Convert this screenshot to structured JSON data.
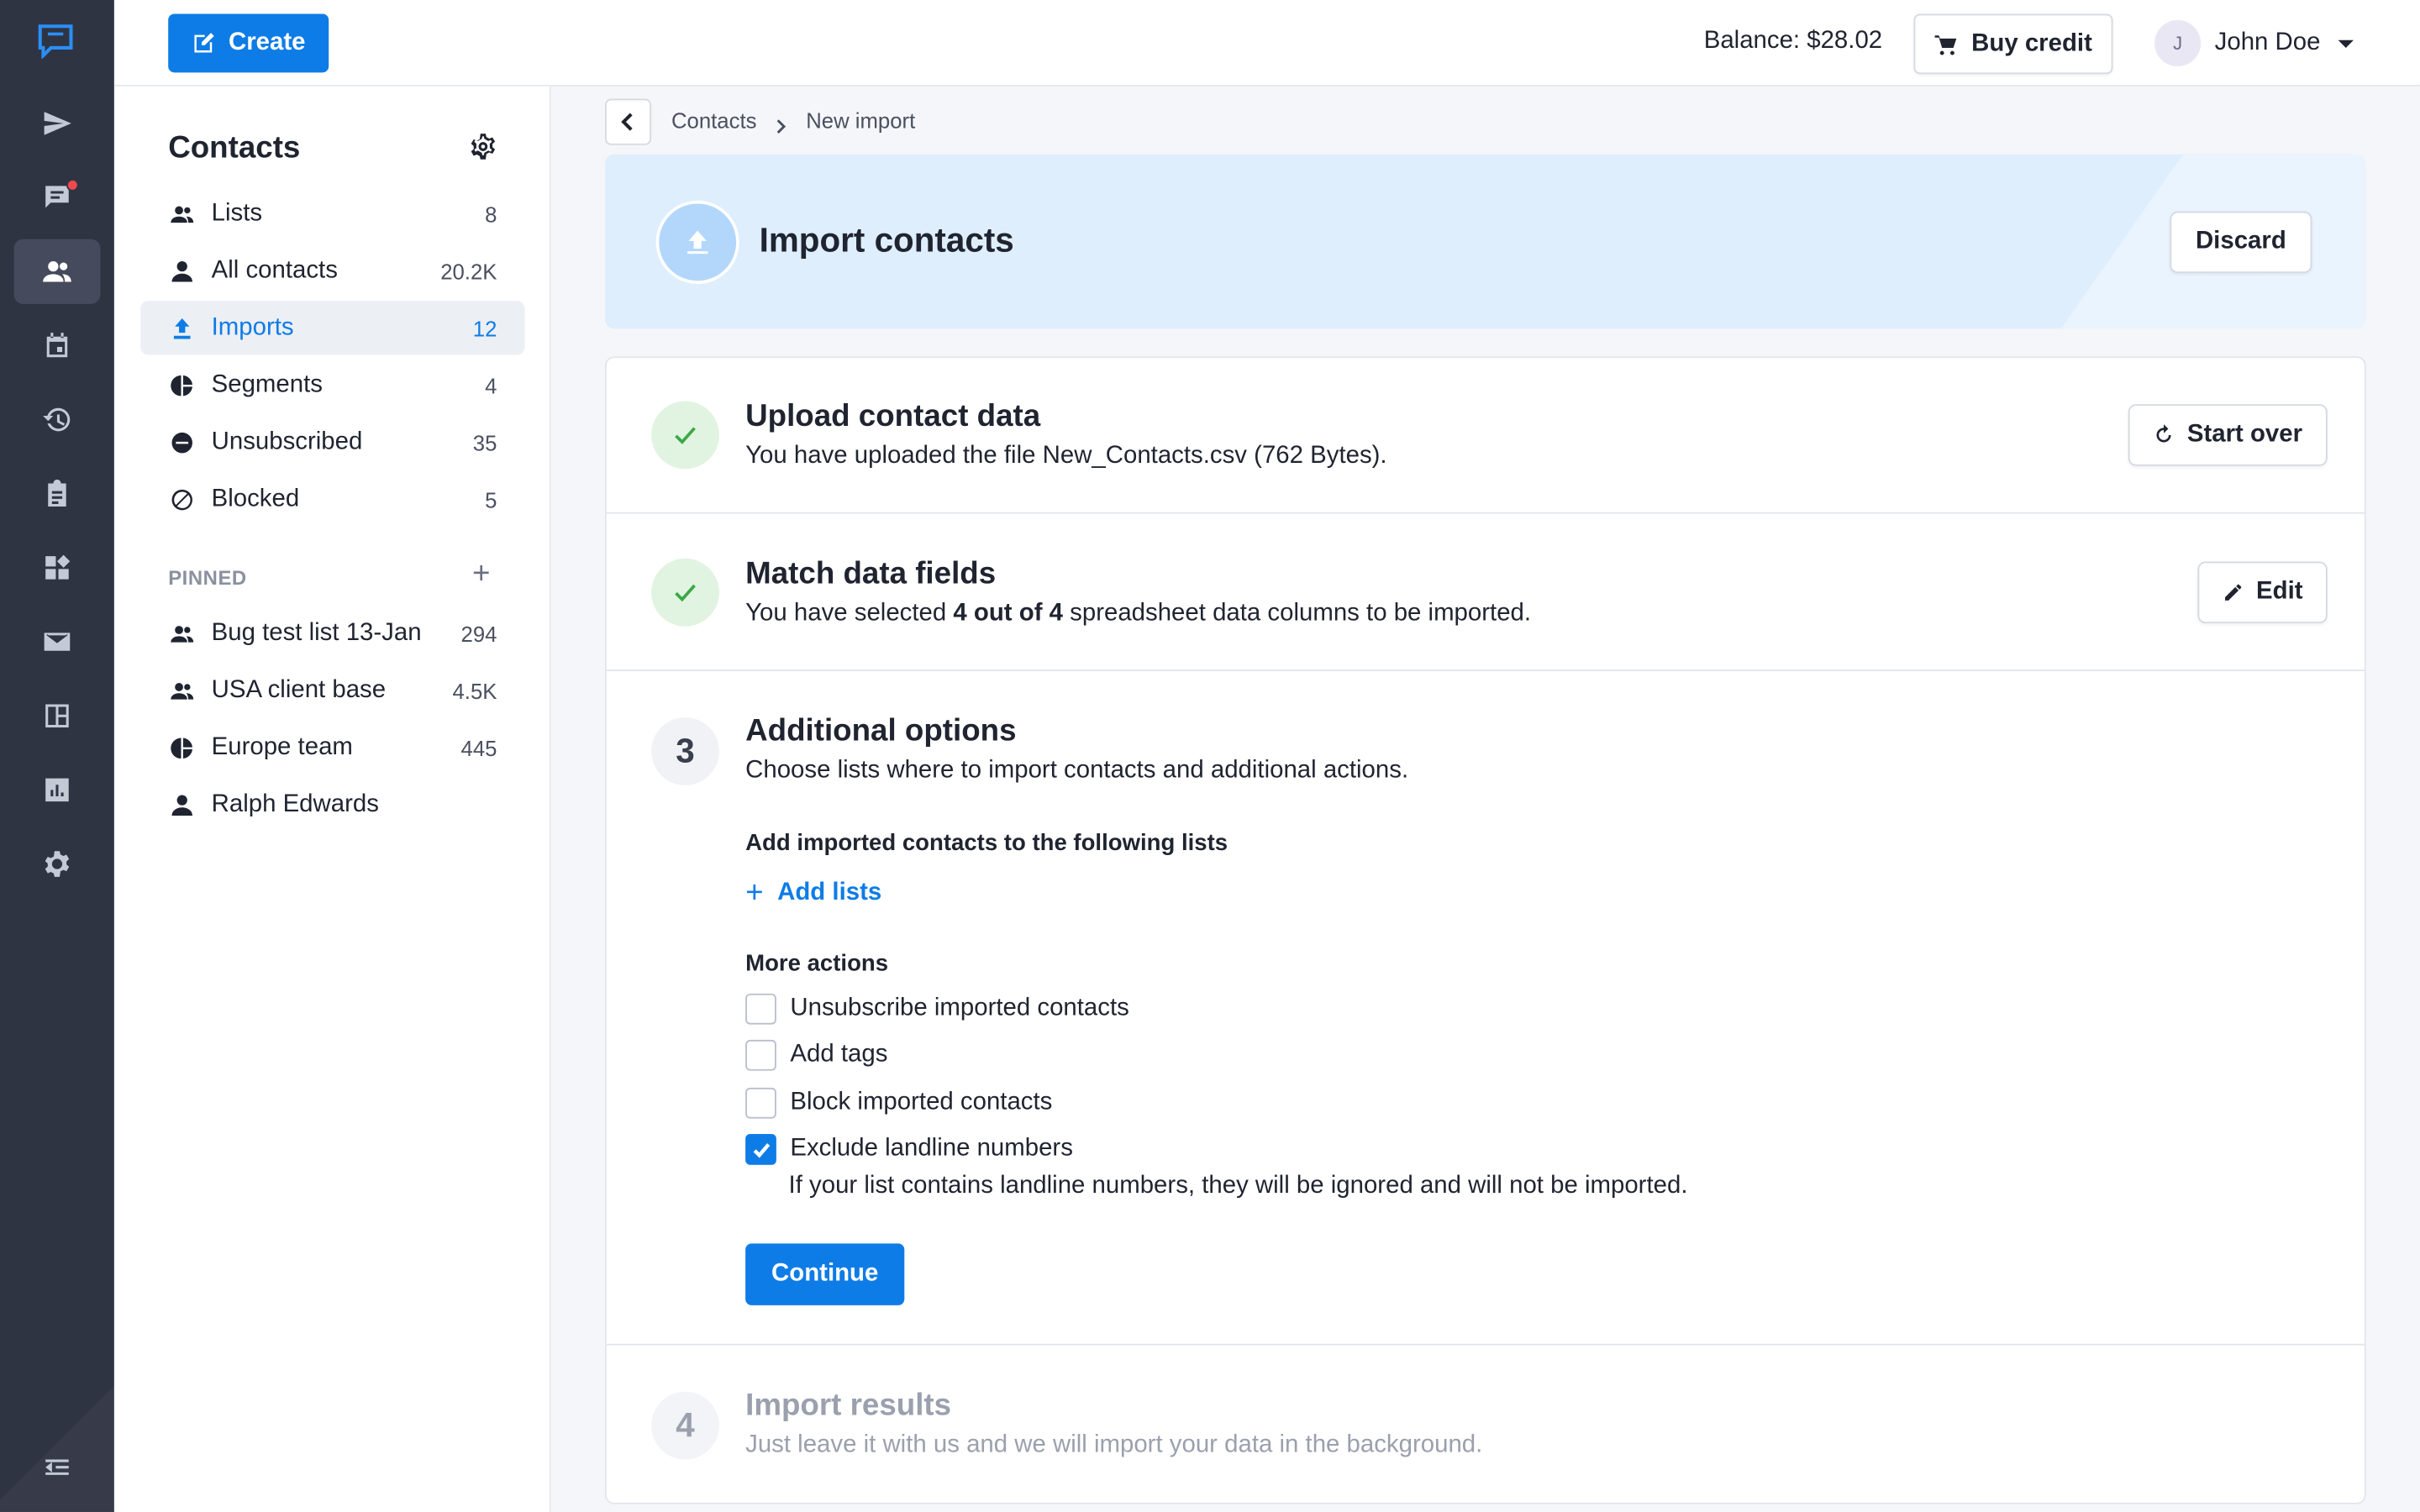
{
  "topbar": {
    "create_label": "Create",
    "balance": "Balance: $28.02",
    "buy_credit_label": "Buy credit",
    "user_initial": "J",
    "user_name": "John Doe"
  },
  "sidebar": {
    "title": "Contacts",
    "items": [
      {
        "label": "Lists",
        "count": "8",
        "icon": "list-icon"
      },
      {
        "label": "All contacts",
        "count": "20.2K",
        "icon": "person-icon"
      },
      {
        "label": "Imports",
        "count": "12",
        "icon": "upload-icon"
      },
      {
        "label": "Segments",
        "count": "4",
        "icon": "pie-icon"
      },
      {
        "label": "Unsubscribed",
        "count": "35",
        "icon": "minus-circle-icon"
      },
      {
        "label": "Blocked",
        "count": "5",
        "icon": "block-icon"
      }
    ],
    "pinned_label": "PINNED",
    "pinned": [
      {
        "label": "Bug test list 13-Jan",
        "count": "294",
        "icon": "list-icon"
      },
      {
        "label": "USA client base",
        "count": "4.5K",
        "icon": "list-icon"
      },
      {
        "label": "Europe team",
        "count": "445",
        "icon": "pie-icon"
      },
      {
        "label": "Ralph Edwards",
        "count": "",
        "icon": "person-icon"
      }
    ]
  },
  "breadcrumb": {
    "items": [
      "Contacts",
      "New import"
    ]
  },
  "banner": {
    "title": "Import contacts",
    "discard_label": "Discard"
  },
  "steps": {
    "upload": {
      "title": "Upload contact data",
      "desc_prefix": "You have uploaded the file ",
      "file_name": "New_Contacts.csv",
      "desc_suffix": " (762 Bytes).",
      "action_label": "Start over"
    },
    "match": {
      "title": "Match data fields",
      "desc_prefix": "You have selected ",
      "selected": "4 out of 4",
      "desc_suffix": " spreadsheet data columns to be imported.",
      "action_label": "Edit"
    },
    "options": {
      "number": "3",
      "title": "Additional options",
      "desc": "Choose lists where to import contacts and additional actions.",
      "lists_label": "Add imported contacts to the following lists",
      "add_lists_label": "Add lists",
      "more_actions_label": "More actions",
      "checkboxes": [
        {
          "label": "Unsubscribe imported contacts",
          "checked": false
        },
        {
          "label": "Add tags",
          "checked": false
        },
        {
          "label": "Block imported contacts",
          "checked": false
        },
        {
          "label": "Exclude landline numbers",
          "checked": true
        }
      ],
      "landline_help": "If your list contains landline numbers, they will be ignored and will not be imported.",
      "continue_label": "Continue"
    },
    "results": {
      "number": "4",
      "title": "Import results",
      "desc": "Just leave it with us and we will import your data in the background."
    }
  },
  "colors": {
    "accent": "#0e7ce6",
    "rail_bg": "#2f3443",
    "banner_bg": "#dfeefd",
    "success": "#3aa845"
  }
}
